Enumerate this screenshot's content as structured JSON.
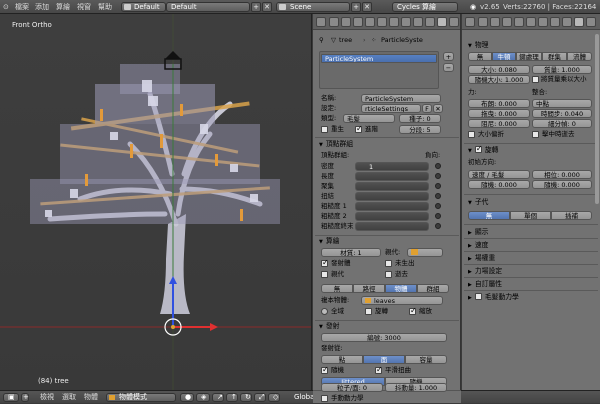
{
  "topbar": {
    "menus": [
      "檔案",
      "添加",
      "算繪",
      "視窗",
      "幫助"
    ],
    "screen_layout": "Default",
    "scene": "Scene",
    "engine": "Cycles 算繪",
    "version": "v2.65",
    "stats": "Verts:22760 | Faces:22164"
  },
  "viewport": {
    "view_label": "Front Ortho",
    "object_label": "(84) tree"
  },
  "bottombar": {
    "menus": [
      "檢視",
      "選取",
      "物體"
    ],
    "mode": "物體模式",
    "pivot": "Global"
  },
  "props": {
    "breadcrumb": [
      "tree",
      "ParticleSyste"
    ],
    "list_item": "ParticleSystem",
    "name_label": "名稱:",
    "name_value": "ParticleSystem",
    "settings_label": "設定:",
    "settings_value": "rticleSettings",
    "settings_users": "F",
    "type_label": "類型:",
    "type_value": "毛髮",
    "seed": "種子: 0",
    "regrow": "重生",
    "advanced": "進階",
    "segments": "分段: 5",
    "vertex_groups": {
      "header": "頂點群組",
      "subheader": "頂點群組:",
      "negate": "負向:",
      "rows": [
        "密度",
        "長度",
        "聚集",
        "扭結",
        "粗糙度 1",
        "粗糙度 2",
        "粗糙度終末"
      ],
      "density_value": "1"
    },
    "render": {
      "header": "算繪",
      "material": "材質: 1",
      "parent_label": "親代:",
      "emitter": "發射體",
      "unborn": "未生出",
      "parents": "親代",
      "died": "逝去",
      "modes": [
        "無",
        "路徑",
        "物體",
        "群組"
      ],
      "active_mode": 2,
      "dupli_object_label": "複本物體:",
      "dupli_object": "leaves",
      "global": "全域",
      "rotation": "旋轉",
      "scale": "縮放"
    },
    "emission": {
      "header": "發射",
      "number": "編號: 3000",
      "emit_from_label": "發射從:",
      "from_modes": [
        "點",
        "面",
        "容量"
      ],
      "active_from": 1,
      "random": "隨機",
      "even": "平滑扭曲",
      "distribution": [
        "Jittered",
        "隨機"
      ],
      "particles_per_face": "粒子/面: 0",
      "jitter": "抖動量: 1.000",
      "manual_hair": "手動動力學"
    }
  },
  "physics": {
    "header": "物理",
    "types": [
      "無",
      "牛頓",
      "鍵處理",
      "群集",
      "流體"
    ],
    "active_type": 1,
    "size": "大小: 0.080",
    "mass": "質量: 1.000",
    "random_size": "隨機大小: 1.000",
    "mass_size": "將質量乘以大小",
    "forces_label": "力:",
    "integration_label": "整合:",
    "brownian": "布朗: 0.000",
    "integrator": "中點",
    "drag": "拖曳: 0.000",
    "timestep": "時間步: 0.040",
    "damp": "阻尼: 0.000",
    "subframes": "細分幀: 0",
    "size_deflect": "大小偏折",
    "die_on_hit": "擊中時逝去",
    "rotation_header": "旋轉",
    "initial_orientation": "初始方向:",
    "orientation_value": "速度 / 毛髮",
    "phase": "相位: 0.000",
    "random_a": "隨機: 0.000",
    "random_b": "隨機: 0.000",
    "children_header": "子代",
    "children_modes": [
      "無",
      "單個",
      "插補"
    ],
    "active_children": 0,
    "collapsed": [
      "顯示",
      "速度",
      "場權重",
      "力場設定",
      "自訂屬性",
      "毛髮動力學"
    ]
  }
}
